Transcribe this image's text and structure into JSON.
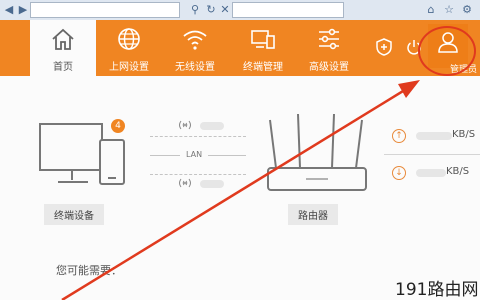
{
  "nav": {
    "home": "首页",
    "internet": "上网设置",
    "wireless": "无线设置",
    "devices": "终端管理",
    "advanced": "高级设置",
    "admin": "管理员"
  },
  "main": {
    "terminal_label": "终端设备",
    "router_label": "路由器",
    "device_count": "4",
    "lan_label": "LAN",
    "upload_unit": "KB/S",
    "download_unit": "KB/S",
    "hint": "您可能需要："
  },
  "watermark": "191路由网",
  "colors": {
    "brand": "#f08522",
    "annotation": "#e03a1e"
  }
}
